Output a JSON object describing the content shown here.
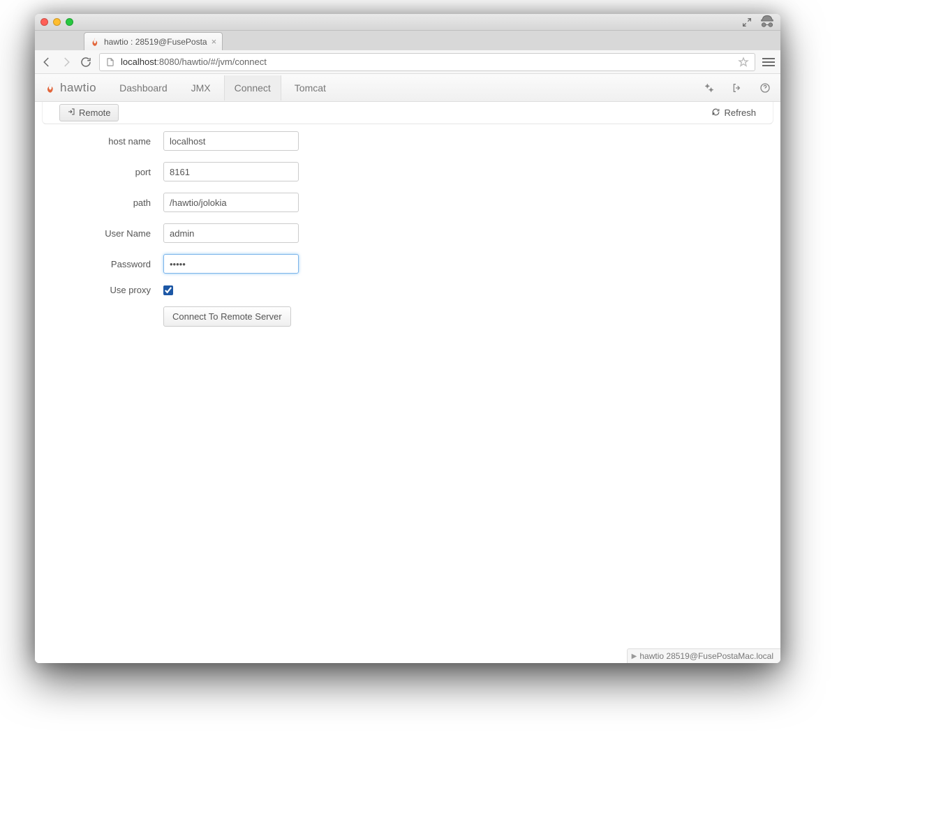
{
  "browser": {
    "tab_title": "hawtio : 28519@FusePosta",
    "url_display_bold": "localhost",
    "url_display_rest": ":8080/hawtio/#/jvm/connect"
  },
  "app": {
    "brand": "hawtio",
    "nav": {
      "dashboard": "Dashboard",
      "jmx": "JMX",
      "connect": "Connect",
      "tomcat": "Tomcat"
    },
    "subbar": {
      "remote_label": "Remote",
      "refresh_label": "Refresh"
    }
  },
  "form": {
    "labels": {
      "hostname": "host name",
      "port": "port",
      "path": "path",
      "username": "User Name",
      "password": "Password",
      "use_proxy": "Use proxy"
    },
    "values": {
      "hostname": "localhost",
      "port": "8161",
      "path": "/hawtio/jolokia",
      "username": "admin",
      "password": "•••••",
      "use_proxy": true
    },
    "submit_label": "Connect To Remote Server"
  },
  "status_bar": "hawtio  28519@FusePostaMac.local"
}
